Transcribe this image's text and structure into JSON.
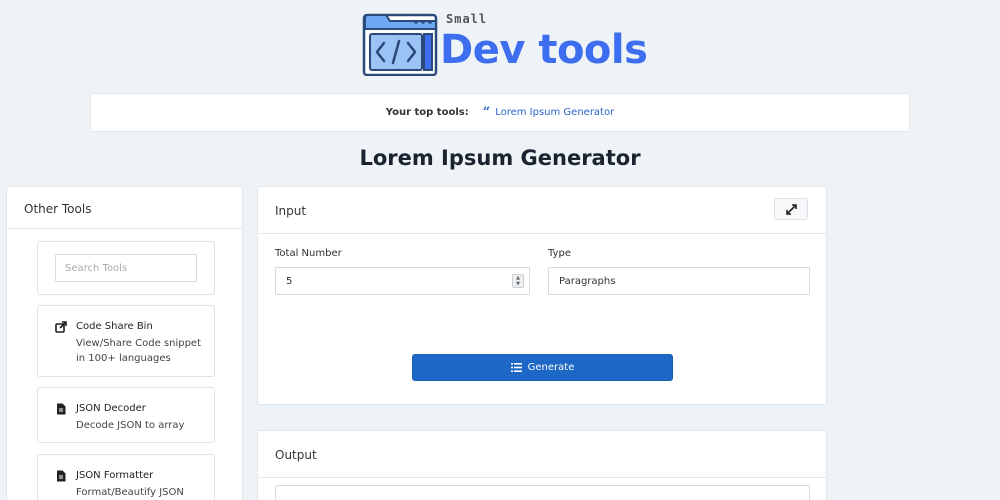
{
  "logo": {
    "small": "Small",
    "main": "Dev tools"
  },
  "topbar": {
    "label": "Your top tools:",
    "link": "Lorem Ipsum Generator"
  },
  "page": {
    "title": "Lorem Ipsum Generator"
  },
  "sidebar": {
    "title": "Other Tools",
    "search_placeholder": "Search Tools",
    "tools": [
      {
        "title": "Code Share Bin",
        "desc": "View/Share Code snippet in 100+ languages",
        "icon": "share-icon"
      },
      {
        "title": "JSON Decoder",
        "desc": "Decode JSON to array",
        "icon": "file-icon"
      },
      {
        "title": "JSON Formatter",
        "desc": "Format/Beautify JSON",
        "icon": "file-icon"
      }
    ]
  },
  "input_panel": {
    "title": "Input",
    "total_label": "Total Number",
    "total_value": "5",
    "type_label": "Type",
    "type_value": "Paragraphs",
    "generate_label": "Generate"
  },
  "output_panel": {
    "title": "Output"
  },
  "colors": {
    "brand": "#3d6ef0",
    "button": "#1d67c6",
    "link": "#2a64c8",
    "background": "#eef3f7"
  }
}
